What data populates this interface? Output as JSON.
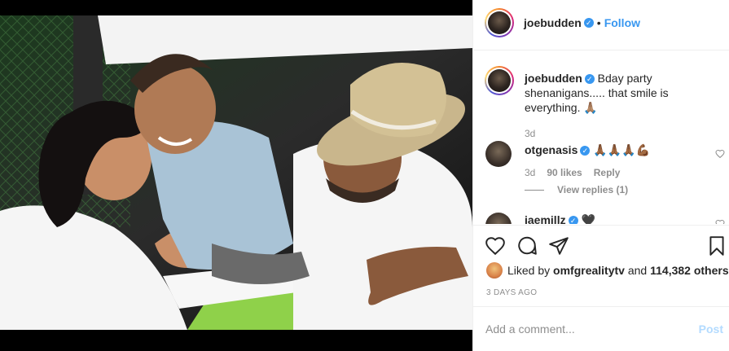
{
  "post": {
    "author": "joebudden",
    "follow_label": "Follow",
    "caption_text": "Bday party shenanigans..... that smile is everything. 🙏🏽",
    "caption_age": "3d"
  },
  "comments": [
    {
      "user": "otgenasis",
      "text": "🙏🏾🙏🏾🙏🏾💪🏾",
      "age": "3d",
      "likes": "90 likes",
      "reply_label": "Reply",
      "view_replies": "View replies (1)"
    },
    {
      "user": "jaemillz",
      "text": "🖤"
    }
  ],
  "likes": {
    "prefix": "Liked by",
    "user": "omfgrealitytv",
    "and": "and",
    "others": "114,382 others"
  },
  "timestamp": "3 DAYS AGO",
  "comment_box": {
    "placeholder": "Add a comment...",
    "post_label": "Post"
  },
  "colors": {
    "link_blue": "#3897f0",
    "post_disabled": "#b3dbff",
    "muted": "#8e8e8e",
    "text": "#262626"
  },
  "icons": [
    "verified-badge-icon",
    "heart-icon",
    "comment-icon",
    "share-icon",
    "bookmark-icon"
  ]
}
